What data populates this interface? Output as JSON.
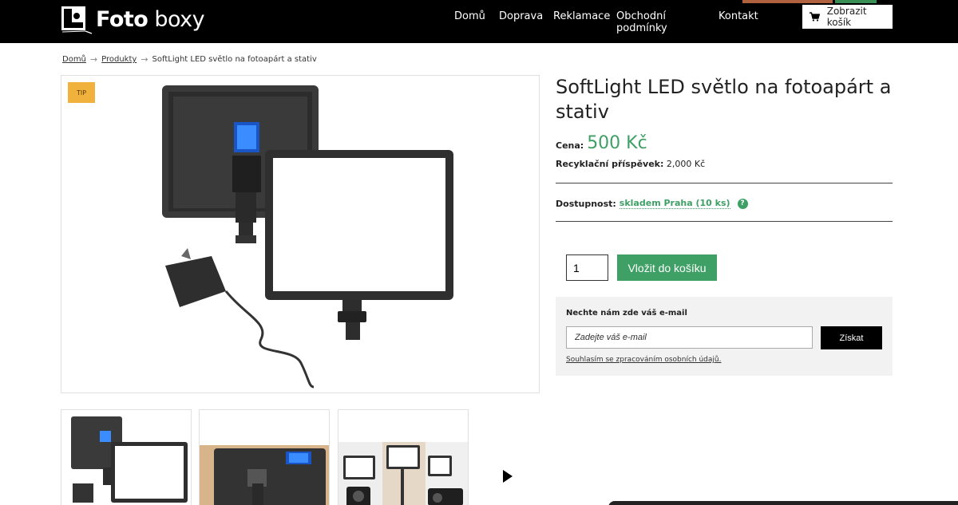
{
  "site": {
    "brand_bold": "Foto",
    "brand_light": "boxy",
    "accent_colors": [
      "#b0623e",
      "#3a8f55"
    ]
  },
  "nav": {
    "items": [
      "Domů",
      "Doprava",
      "Reklamace",
      "Obchodní podmínky",
      "Kontakt"
    ]
  },
  "cart": {
    "label": "Zobrazit košík",
    "icon": "cart-icon"
  },
  "breadcrumb": {
    "items": [
      "Domů",
      "Produkty"
    ],
    "current": "SoftLight LED světlo na fotoapárt a stativ"
  },
  "gallery": {
    "badge": "TIP",
    "next_icon": "play-triangle-icon"
  },
  "product": {
    "title": "SoftLight LED světlo na fotoapárt a stativ",
    "price_label": "Cena:",
    "price": "500 Kč",
    "recycle_label": "Recyklační příspěvek:",
    "recycle_value": "2,000 Kč",
    "availability_label": "Dostupnost:",
    "availability_value": "skladem Praha (10 ks)",
    "help_icon": "question-circle-icon",
    "quantity": "1",
    "add_to_cart": "Vložit do košíku",
    "price_color": "#3fa066"
  },
  "email_signup": {
    "heading": "Nechte nám zde váš e-mail",
    "placeholder": "Zadejte váš e-mail",
    "submit": "Získat",
    "consent": "Souhlasím se zpracováním osobních údajů."
  }
}
